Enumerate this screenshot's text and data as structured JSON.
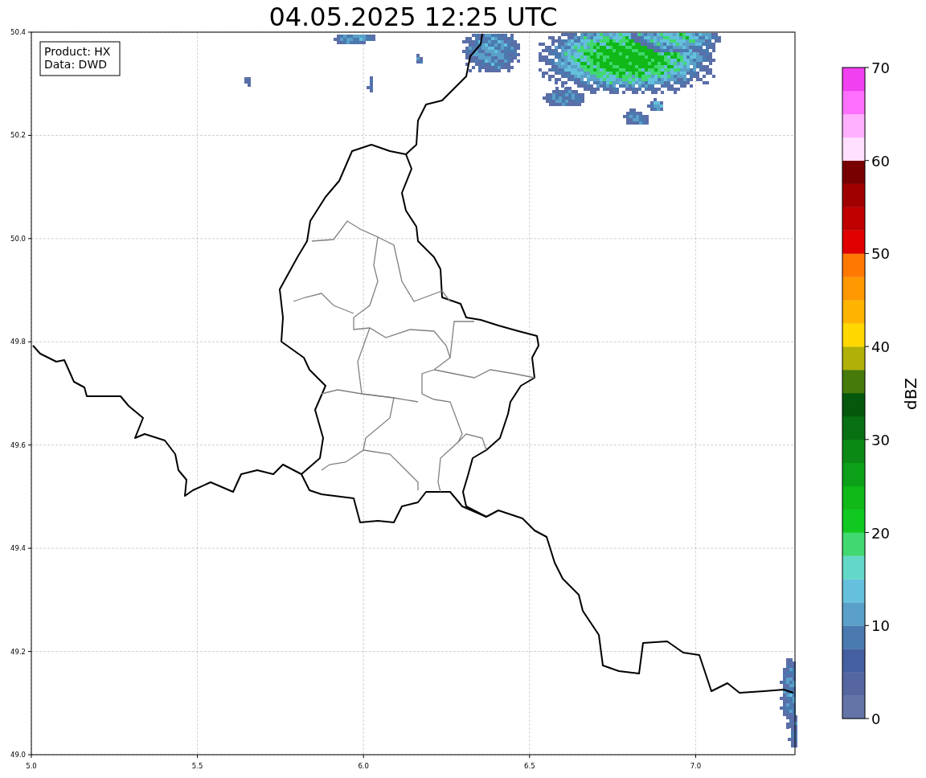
{
  "title": "04.05.2025 12:25 UTC",
  "info_box": [
    "Product: HX",
    "Data: DWD"
  ],
  "x_ticks": [
    "5.0",
    "5.5",
    "6.0",
    "6.5",
    "7.0"
  ],
  "y_ticks": [
    "50.4",
    "50.2",
    "50.0",
    "49.8",
    "49.6",
    "49.4",
    "49.2",
    "49.0"
  ],
  "colorbar": {
    "label": "dBZ",
    "ticks": [
      "70",
      "60",
      "50",
      "40",
      "30",
      "20",
      "10",
      "0"
    ],
    "bands": [
      {
        "color": "#6474a6"
      },
      {
        "color": "#5666a0"
      },
      {
        "color": "#4560a0"
      },
      {
        "color": "#4a7ab0"
      },
      {
        "color": "#5aa0c8"
      },
      {
        "color": "#64c0dc"
      },
      {
        "color": "#64d8c8"
      },
      {
        "color": "#40d870"
      },
      {
        "color": "#10c820"
      },
      {
        "color": "#10b818"
      },
      {
        "color": "#0ca018"
      },
      {
        "color": "#0a8a14"
      },
      {
        "color": "#087012"
      },
      {
        "color": "#06580c"
      },
      {
        "color": "#467a0a"
      },
      {
        "color": "#b0b008"
      },
      {
        "color": "#ffd800"
      },
      {
        "color": "#ffb400"
      },
      {
        "color": "#ff9800"
      },
      {
        "color": "#ff7800"
      },
      {
        "color": "#e00000"
      },
      {
        "color": "#c00000"
      },
      {
        "color": "#a00000"
      },
      {
        "color": "#780000"
      },
      {
        "color": "#ffe0ff"
      },
      {
        "color": "#ffb0ff"
      },
      {
        "color": "#ff70ff"
      },
      {
        "color": "#f040f0"
      }
    ]
  }
}
